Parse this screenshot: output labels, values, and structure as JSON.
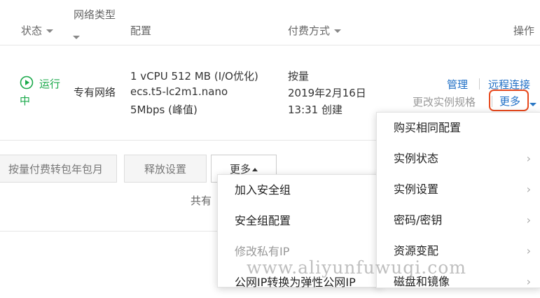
{
  "headers": {
    "status": "状态",
    "network_type": "网络类型",
    "config": "配置",
    "billing": "付费方式",
    "actions": "操作"
  },
  "row": {
    "status": "运行中",
    "network": "专有网络",
    "config_line1": "1 vCPU 512 MB (I/O优化)",
    "config_line2": "ecs.t5-lc2m1.nano",
    "config_line3": "5Mbps (峰值)",
    "billing_line1": "按量",
    "billing_line2": "2019年2月16日",
    "billing_line3": "13:31 创建",
    "manage": "管理",
    "remote": "远程连接",
    "change_spec": "更改实例规格",
    "more": "更多"
  },
  "toolbar": {
    "convert": "按量付费转包年包月",
    "release": "释放设置",
    "more": "更多"
  },
  "total_text": "共有",
  "left_menu": [
    {
      "label": "加入安全组",
      "disabled": false
    },
    {
      "label": "安全组配置",
      "disabled": false
    },
    {
      "label": "修改私有IP",
      "disabled": true
    },
    {
      "label": "公网IP转换为弹性公网IP",
      "disabled": false
    }
  ],
  "right_menu": [
    {
      "label": "购买相同配置",
      "submenu": false
    },
    {
      "label": "实例状态",
      "submenu": true
    },
    {
      "label": "实例设置",
      "submenu": true
    },
    {
      "label": "密码/密钥",
      "submenu": true
    },
    {
      "label": "资源变配",
      "submenu": true
    },
    {
      "label": "磁盘和镜像",
      "submenu": true
    }
  ],
  "watermark": "www.aliyunfuwuqi.com",
  "colors": {
    "running": "#1aa94a",
    "link": "#1f6fc6",
    "highlight": "#e8491d"
  }
}
